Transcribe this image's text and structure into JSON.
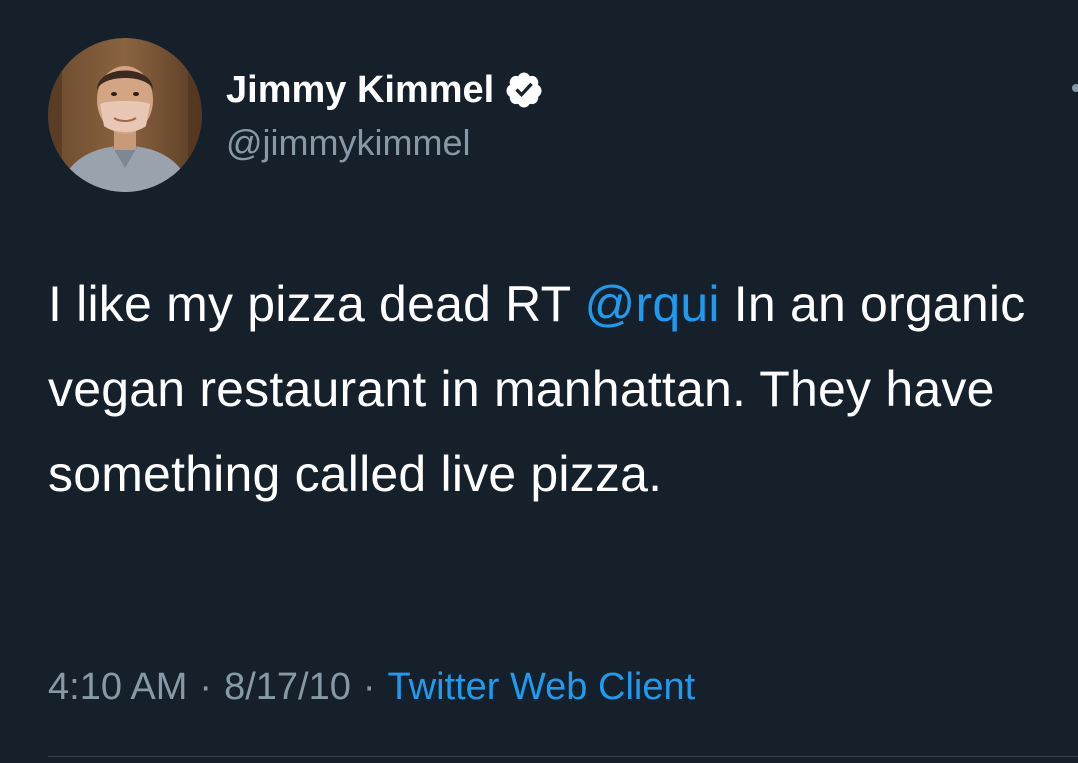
{
  "author": {
    "display_name": "Jimmy Kimmel",
    "handle": "@jimmykimmel",
    "verified": true,
    "verified_icon": "verified-badge-icon"
  },
  "tweet": {
    "text_before": "I like my pizza dead RT ",
    "mention": "@rqui",
    "text_after": " In an organic vegan restaurant in manhattan. They have something called live pizza."
  },
  "meta": {
    "time": "4:10 AM",
    "separator": "·",
    "date": "8/17/10",
    "source": "Twitter Web Client"
  },
  "colors": {
    "background": "#15202b",
    "text": "#ffffff",
    "secondary": "#8899a6",
    "accent": "#1d9bf0"
  }
}
